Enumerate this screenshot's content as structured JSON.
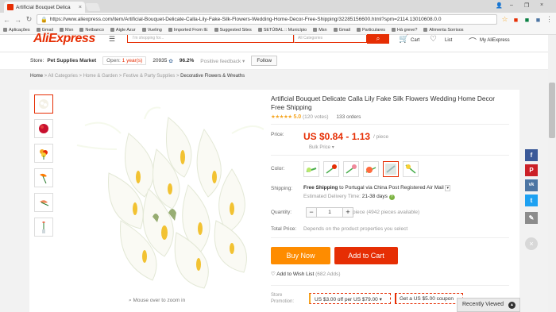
{
  "browser": {
    "tab_title": "Artificial Bouquet Delica",
    "url": "https://www.aliexpress.com/item/Artificial-Bouquet-Delicate-Calla-Lily-Fake-Silk-Flowers-Wedding-Home-Decor-Free-Shipping/32285156600.html?spm=2114.13010608.0.0",
    "bookmarks": [
      "Aplicações",
      "Gmail",
      "Msn",
      "Netbanco",
      "Aigle Azur",
      "Vueling",
      "Imported From IE",
      "Suggested Sites",
      "SETÚBAL :: Município",
      "Msn",
      "Gmail",
      "Particulares",
      "Há greve?",
      "Alimenta Sorrisos"
    ]
  },
  "header": {
    "logo": "AliExpress",
    "search_placeholder": "I'm shopping for...",
    "category_placeholder": "All Categories",
    "cart_label": "Cart",
    "wishlist_label": "List",
    "account_label": "My AliExpress"
  },
  "store": {
    "label": "Store:",
    "name": "Pet Supplies Market",
    "open_prefix": "Open:",
    "open_years": "1 year(s)",
    "score": "20935",
    "feedback_pct": "96.2%",
    "feedback_label": "Positive feedback",
    "follow_label": "Follow"
  },
  "breadcrumb": [
    "Home",
    "All Categories",
    "Home & Garden",
    "Festive & Party Supplies",
    "Decorative Flowers & Wreaths"
  ],
  "product": {
    "title": "Artificial Bouquet Delicate Calla Lily Fake Silk Flowers Wedding Home Decor Free Shipping",
    "rating": "5.0",
    "votes": "(120 votes)",
    "orders": "133 orders",
    "price_label": "Price:",
    "price": "US $0.84 - 1.13",
    "per_piece": "/ piece",
    "bulk_price": "Bulk Price",
    "color_label": "Color:",
    "shipping_label": "Shipping:",
    "shipping_prefix": "Free Shipping",
    "shipping_rest": "to Portugal via China Post Registered Air Mail",
    "delivery_label": "Estimated Delivery Time:",
    "delivery_days": "21-38 days",
    "quantity_label": "Quantity:",
    "quantity": "1",
    "available": "piece (4942 pieces available)",
    "total_label": "Total Price:",
    "total_text": "Depends on the product properties you select",
    "buy_now": "Buy Now",
    "add_to_cart": "Add to Cart",
    "wishlist": "Add to Wish List",
    "wishlist_count": "(682 Adds)",
    "promo_label_1": "Store",
    "promo_label_2": "Promotion:",
    "coupon_1": "US $3.00 off per US $79.00",
    "coupon_2": "Get a US $5.00 coupon",
    "zoom_hint": "Mouse over to zoom in"
  },
  "share": [
    {
      "name": "facebook",
      "glyph": "f",
      "color": "#3b5998"
    },
    {
      "name": "pinterest",
      "glyph": "P",
      "color": "#cb2027"
    },
    {
      "name": "vk",
      "glyph": "vk",
      "color": "#4c75a3"
    },
    {
      "name": "twitter",
      "glyph": "t",
      "color": "#1da1f2"
    },
    {
      "name": "edit",
      "glyph": "✎",
      "color": "#8c8c8c"
    }
  ],
  "recently_viewed": "Recently Viewed",
  "colors": {
    "accent": "#e62e04",
    "buy": "#fe8c00",
    "star": "#f5a623"
  }
}
